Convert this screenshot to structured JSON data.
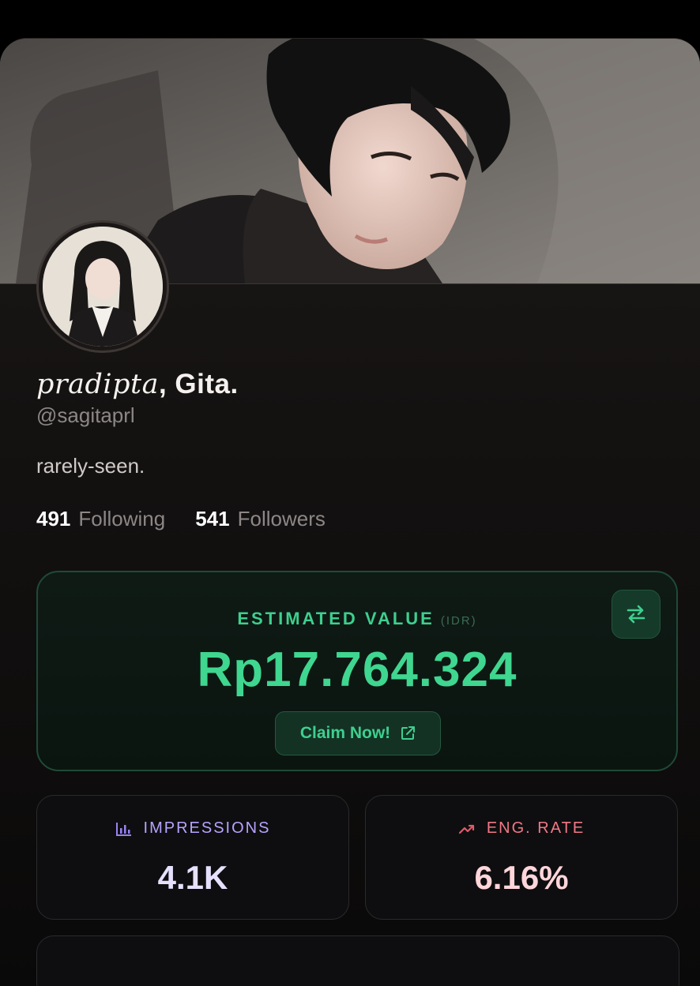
{
  "profile": {
    "name_italic": "pradipta",
    "name_rest": ", Gita.",
    "handle": "@sagitaprl",
    "bio": "rarely-seen.",
    "following_count": "491",
    "following_label": "Following",
    "followers_count": "541",
    "followers_label": "Followers"
  },
  "value_card": {
    "title": "ESTIMATED VALUE",
    "currency": "(IDR)",
    "amount": "Rp17.764.324",
    "claim_label": "Claim Now!",
    "swap_icon": "swap-arrows-icon",
    "external_icon": "external-link-icon",
    "accent_color": "#3fd690"
  },
  "metrics": [
    {
      "label": "IMPRESSIONS",
      "value": "4.1K",
      "icon": "bar-chart-icon",
      "color": "#9a82f0",
      "value_color": "#e6e0ff"
    },
    {
      "label": "ENG. RATE",
      "value": "6.16%",
      "icon": "trending-up-icon",
      "color": "#e05a6a",
      "value_color": "#ffd6da"
    }
  ]
}
